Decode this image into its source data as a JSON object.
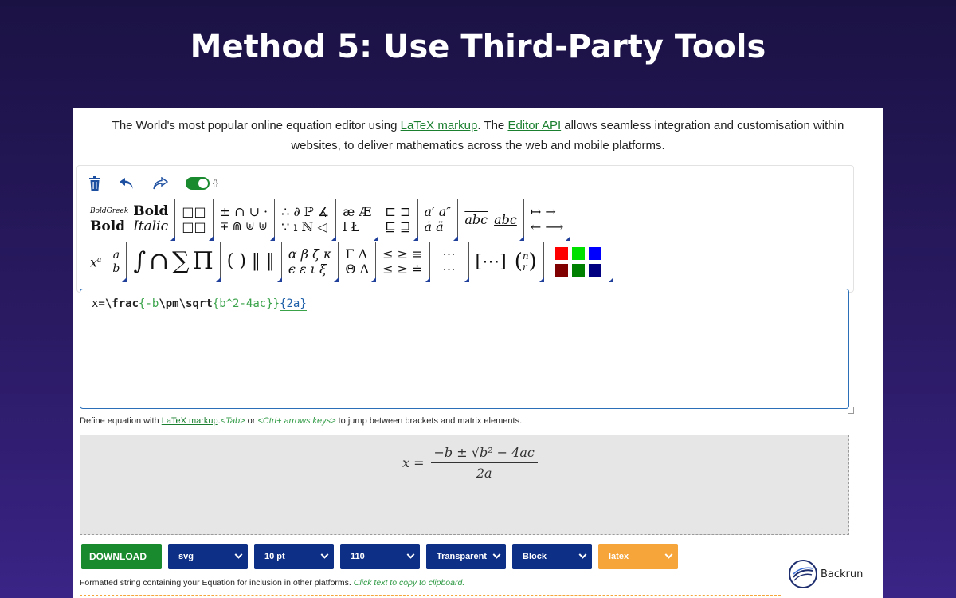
{
  "slide": {
    "title": "Method 5: Use Third-Party Tools"
  },
  "intro": {
    "part1": "The World's most popular online equation editor using ",
    "link1": "LaTeX markup",
    "part2": ". The ",
    "link2": "Editor API",
    "part3": " allows seamless integration and customisation within websites, to deliver mathematics across the web and mobile platforms."
  },
  "toolbar": {
    "delete_icon": "trash-icon",
    "undo_icon": "undo-icon",
    "redo_icon": "redo-icon",
    "toggle_label": "{}"
  },
  "palette": {
    "row1": [
      [
        "BoldGreek Bold",
        "Bold Italic"
      ],
      [
        "□□",
        "□□"
      ],
      [
        "± ∩ ∪ ·",
        "∓ ⋒ ⊎ ⊎"
      ],
      [
        "∴ ∂ ℙ ∡",
        "∵ ı ℕ ◁"
      ],
      [
        "æ Æ",
        "l Ł"
      ],
      [
        "⊏ ⊐",
        "⊑ ⊒"
      ],
      [
        "a′ a″",
        "ȧ ä"
      ],
      [
        "abc abc"
      ],
      [
        "↦ →",
        "← ⟶"
      ]
    ],
    "row2": [
      [
        "xᵃ  a/b"
      ],
      [
        "∫ ∩ ∑ Π"
      ],
      [
        "( ) ‖ ‖"
      ],
      [
        "α β ζ κ",
        "ϵ ε ι ξ"
      ],
      [
        "Γ Δ",
        "Θ Λ"
      ],
      [
        "≤ ≥ ≡",
        "≤ ≥ ≐"
      ],
      [
        "⋯",
        "⋯"
      ],
      [
        "[⋯]  (n r)"
      ]
    ],
    "swatches": [
      "#ff0000",
      "#00e000",
      "#0000ff",
      "#800000",
      "#008000",
      "#000080"
    ]
  },
  "editor": {
    "segments": [
      {
        "t": "x=",
        "c": "plain"
      },
      {
        "t": "\\frac",
        "c": "kw"
      },
      {
        "t": "{",
        "c": "br"
      },
      {
        "t": "-b",
        "c": "gr"
      },
      {
        "t": "\\pm\\sqrt",
        "c": "kw"
      },
      {
        "t": "{",
        "c": "br"
      },
      {
        "t": "b^2-4ac",
        "c": "gr"
      },
      {
        "t": "}}",
        "c": "br"
      },
      {
        "t": "{2a}",
        "c": "hl"
      }
    ]
  },
  "hint": {
    "part1": "Define equation with ",
    "link": "LaTeX markup",
    "part2": ".",
    "tab": "<Tab>",
    "or": " or ",
    "ctrl": "<Ctrl+ arrows keys>",
    "part3": " to jump between brackets and matrix elements."
  },
  "preview": {
    "lhs": "x =",
    "numerator": "−b ± √b² − 4ac",
    "denominator": "2a"
  },
  "controls": {
    "download": "DOWNLOAD",
    "format": "svg",
    "size": "10 pt",
    "dpi": "110",
    "background": "Transparent",
    "display": "Block",
    "output": "latex"
  },
  "footer": {
    "text": "Formatted string containing your Equation for inclusion in other platforms. ",
    "hint": "Click text to copy to clipboard."
  },
  "brand": {
    "name": "Backrun"
  },
  "colors": {
    "accent_green": "#1a8a2f",
    "select_blue": "#0d2f85",
    "latex_orange": "#f5a53a"
  }
}
